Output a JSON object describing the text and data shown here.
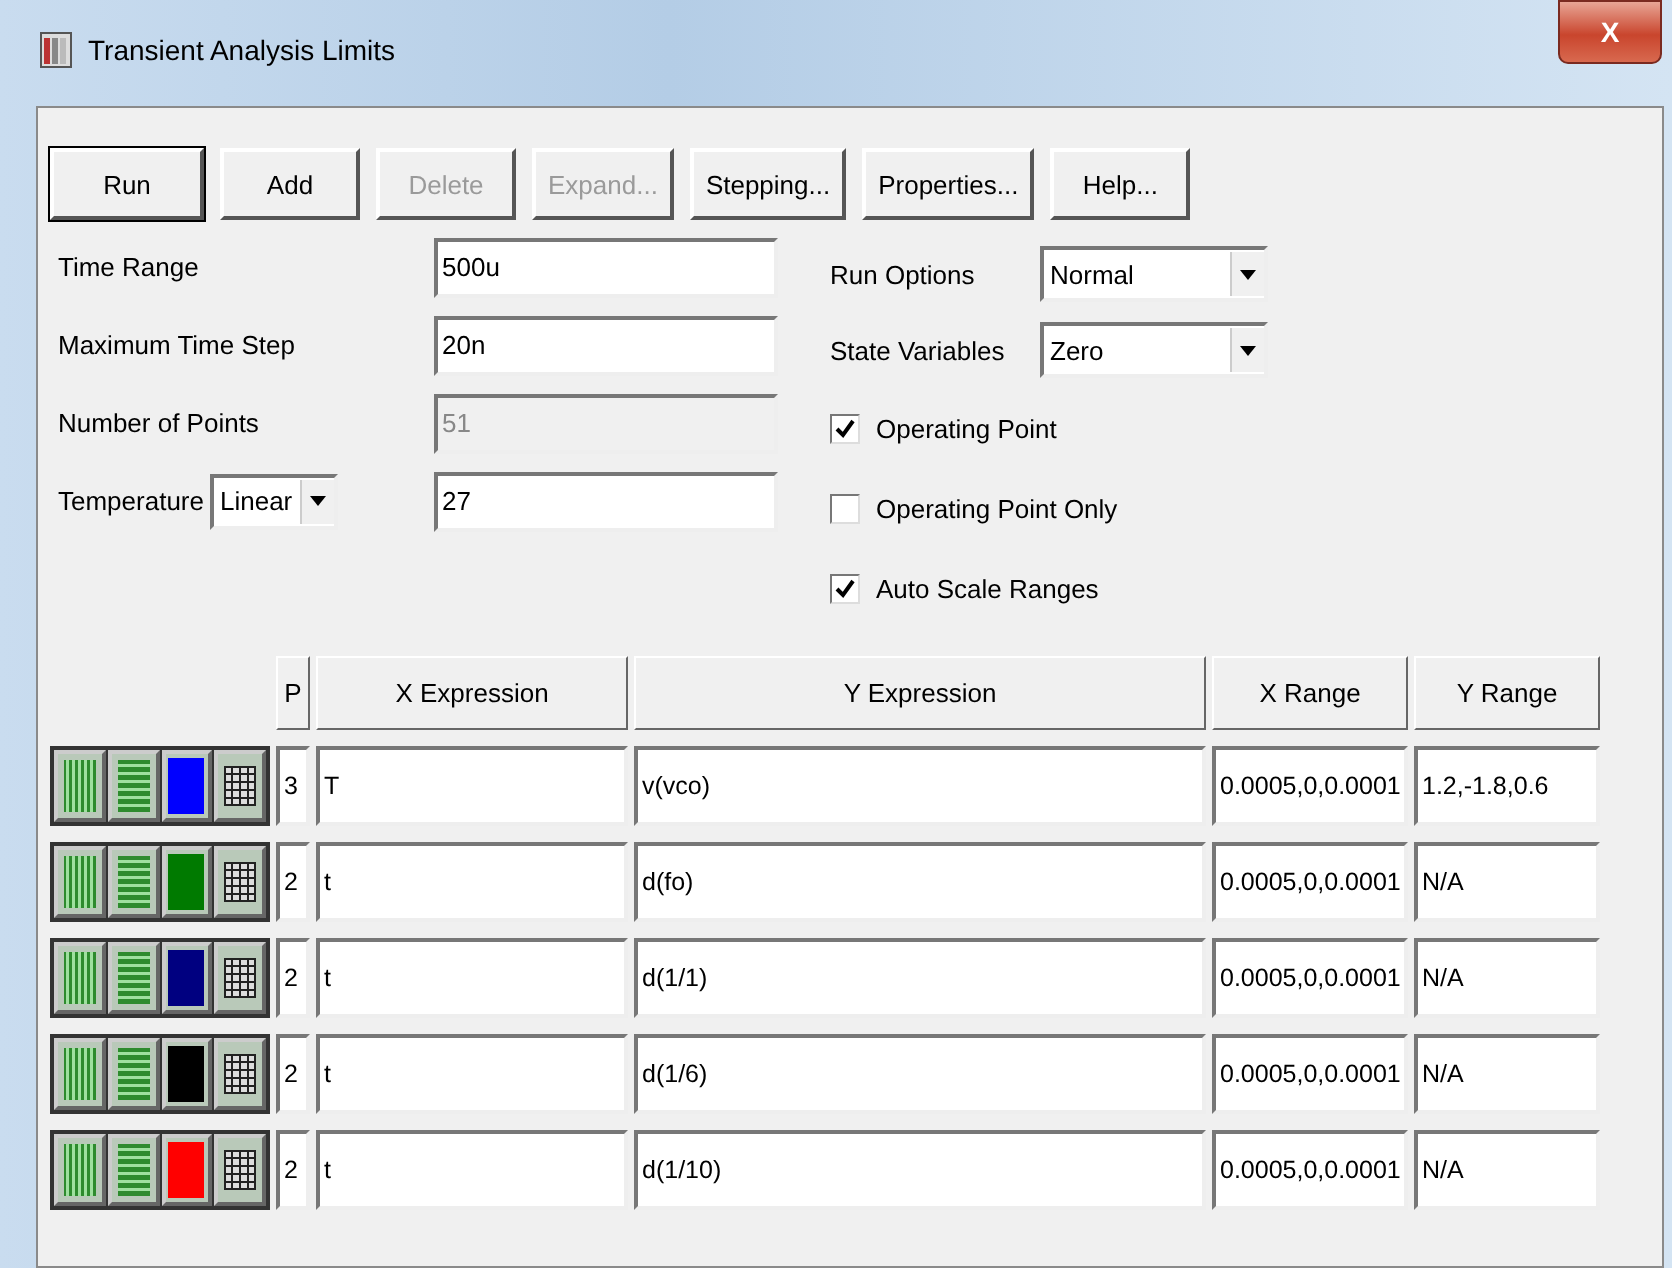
{
  "window": {
    "title": "Transient Analysis Limits",
    "close_label": "X"
  },
  "buttons": [
    {
      "label": "Run",
      "disabled": false,
      "selected": true
    },
    {
      "label": "Add",
      "disabled": false,
      "selected": false
    },
    {
      "label": "Delete",
      "disabled": true,
      "selected": false
    },
    {
      "label": "Expand...",
      "disabled": true,
      "selected": false
    },
    {
      "label": "Stepping...",
      "disabled": false,
      "selected": false
    },
    {
      "label": "Properties...",
      "disabled": false,
      "selected": false
    },
    {
      "label": "Help...",
      "disabled": false,
      "selected": false
    }
  ],
  "fields": [
    {
      "label": "Time Range",
      "value": "500u",
      "disabled": false
    },
    {
      "label": "Maximum Time Step",
      "value": "20n",
      "disabled": false
    },
    {
      "label": "Number of Points",
      "value": "51",
      "disabled": true
    },
    {
      "label": "Temperature",
      "mode": "Linear",
      "value": "27",
      "disabled": false
    }
  ],
  "options": [
    {
      "label": "Run Options",
      "value": "Normal"
    },
    {
      "label": "State Variables",
      "value": "Zero"
    }
  ],
  "checkboxes": [
    {
      "label": "Operating Point",
      "checked": true
    },
    {
      "label": "Operating Point Only",
      "checked": false
    },
    {
      "label": "Auto Scale Ranges",
      "checked": true
    }
  ],
  "table": {
    "columns": [
      "P",
      "X Expression",
      "Y Expression",
      "X Range",
      "Y Range"
    ],
    "rows": [
      {
        "p": "3",
        "x_expression": "T",
        "y_expression": "v(vco)",
        "x_range": "0.0005,0,0.0001",
        "y_range": "1.2,-1.8,0.6",
        "color": "#0000ff"
      },
      {
        "p": "2",
        "x_expression": "t",
        "y_expression": "d(fo)",
        "x_range": "0.0005,0,0.0001",
        "y_range": "N/A",
        "color": "#007a00"
      },
      {
        "p": "2",
        "x_expression": "t",
        "y_expression": "d(1/1)",
        "x_range": "0.0005,0,0.0001",
        "y_range": "N/A",
        "color": "#000080"
      },
      {
        "p": "2",
        "x_expression": "t",
        "y_expression": "d(1/6)",
        "x_range": "0.0005,0,0.0001",
        "y_range": "N/A",
        "color": "#000000"
      },
      {
        "p": "2",
        "x_expression": "t",
        "y_expression": "d(1/10)",
        "x_range": "0.0005,0,0.0001",
        "y_range": "N/A",
        "color": "#ff0000"
      }
    ]
  }
}
